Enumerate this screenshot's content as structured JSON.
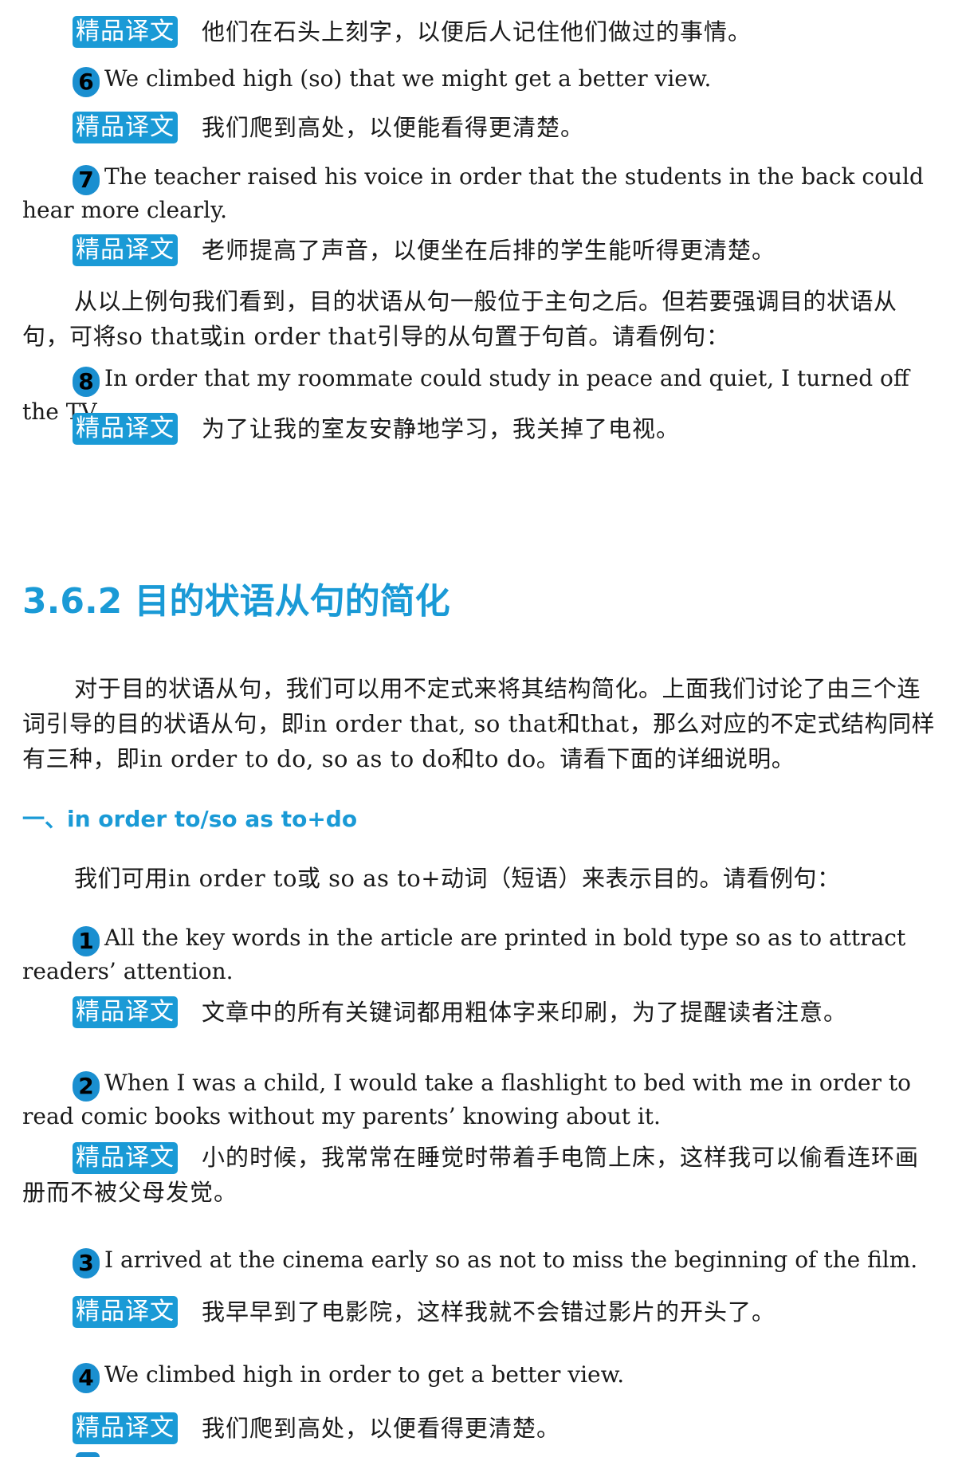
{
  "badge_label": "精品译文",
  "colors": {
    "accent": "#1a9ad6",
    "number_circle": "#1a8fd0"
  },
  "translations": [
    "他们在石头上刻字，以便后人记住他们做过的事情。",
    "我们爬到高处，以便能看得更清楚。",
    "老师提高了声音，以便坐在后排的学生能听得更清楚。",
    "为了让我的室友安静地学习，我关掉了电视。",
    "文章中的所有关键词都用粗体字来印刷，为了提醒读者注意。",
    "小的时候，我常常在睡觉时带着手电筒上床，这样我可以偷看连环画册而不被父母发觉。",
    "我早早到了电影院，这样我就不会错过影片的开头了。",
    "我们爬到高处，以便看得更清楚。"
  ],
  "examples": [
    {
      "num": "6",
      "text": "We climbed high (so) that we might get a better view."
    },
    {
      "num": "7",
      "text": "The teacher raised his voice in order that the students in the back could hear more clearly."
    },
    {
      "num": "8",
      "text": "In order that my roommate could study in peace and quiet, I turned off the TV."
    },
    {
      "num": "1",
      "text": "All the key words in the article are printed in bold type so as to attract readers’ attention."
    },
    {
      "num": "2",
      "text": "When I was a child, I would take a flashlight to bed with me in order to read comic books without my parents’ knowing about it."
    },
    {
      "num": "3",
      "text": "I arrived at the cinema early so as not to miss the beginning of the film."
    },
    {
      "num": "4",
      "text": "We climbed high in order to get a better view."
    }
  ],
  "paragraphs": [
    "从以上例句我们看到，目的状语从句一般位于主句之后。但若要强调目的状语从句，可将so that或in order that引导的从句置于句首。请看例句：",
    "对于目的状语从句，我们可以用不定式来将其结构简化。上面我们讨论了由三个连词引导的目的状语从句，即in order that, so that和that，那么对应的不定式结构同样有三种，即in order to do, so as to do和to do。请看下面的详细说明。",
    "我们可用in order to或 so as to+动词（短语）来表示目的。请看例句："
  ],
  "section_heading": "3.6.2 目的状语从句的简化",
  "subsection_heading": "一、in order to/so as to+do"
}
